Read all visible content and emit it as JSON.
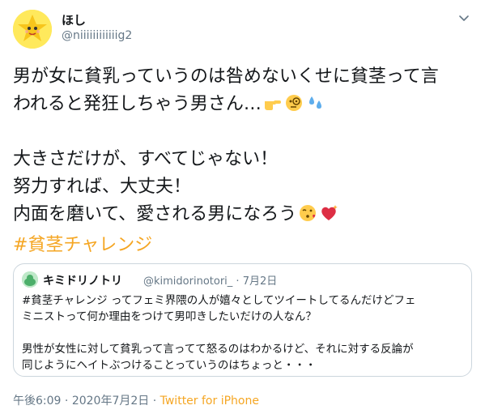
{
  "author": {
    "display_name": "ほし",
    "handle": "@niiiiiiiiiiiig2",
    "avatar_icon": "star-character-avatar"
  },
  "menu_icon": "chevron-down-icon",
  "tweet": {
    "line1": "男が女に貧乳っていうのは咎めないくせに貧茎って言",
    "line2": "われると発狂しちゃう男さん…",
    "line2_emojis": [
      "pointing-hand-emoji",
      "monocle-face-emoji",
      "sweat-droplets-emoji"
    ],
    "line3": "大きさだけが、すべてじゃない！",
    "line4": "努力すれば、大丈夫！",
    "line5": "内面を磨いて、愛される男になろう",
    "line5_emojis": [
      "kissing-face-emoji",
      "sparkling-heart-emoji"
    ],
    "hashtag": "#貧茎チャレンジ"
  },
  "quoted_tweet": {
    "display_name": "キミドリノトリ",
    "handle": "@kimidorinotori_",
    "separator": "·",
    "date": "7月2日",
    "line1": "#貧茎チャレンジ ってフェミ界隈の人が嬉々としてツイートしてるんだけどフェ",
    "line2": "ミニストって何か理由をつけて男叩きしたいだけの人なん？",
    "line3": "男性が女性に対して貧乳って言ってて怒るのはわかるけど、それに対する反論が",
    "line4": "同じようにヘイトぶつけることっていうのはちょっと・・・"
  },
  "footer": {
    "time": "午後6:09",
    "separator": "·",
    "date": "2020年7月2日",
    "separator2": "·",
    "source": "Twitter for iPhone"
  },
  "colors": {
    "accent": "#f5a623",
    "secondary_text": "#657786",
    "border": "#ccd6dd"
  }
}
